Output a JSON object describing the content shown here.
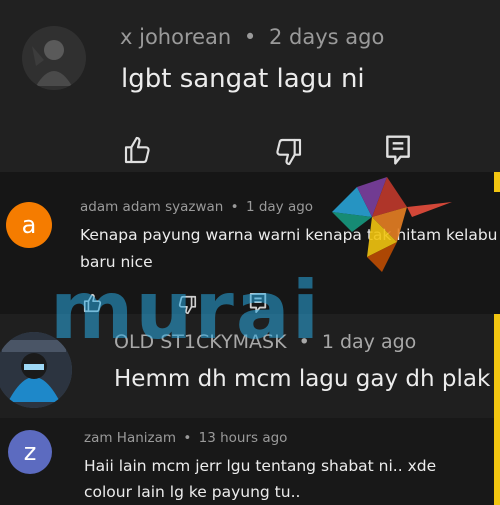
{
  "comments": [
    {
      "author": "x johorean",
      "time": "2 days ago",
      "text": "lgbt sangat lagu ni",
      "avatar_letter": "",
      "avatar_color": "#2a2a2a"
    },
    {
      "author": "adam adam syazwan",
      "time": "1 day ago",
      "text": "Kenapa payung warna warni kenapa tak hitam kelabu baru nice",
      "avatar_letter": "a",
      "avatar_color": "#f57c00"
    },
    {
      "author": "OLD ST1CKYMASK",
      "time": "1 day ago",
      "text": "Hemm dh mcm lagu gay dh plak",
      "avatar_letter": "",
      "avatar_color": "#3a4a5c"
    },
    {
      "author": "zam Hanizam",
      "time": "13 hours ago",
      "text": "Haii lain mcm jerr lgu tentang shabat ni.. xde colour lain lg ke payung tu..",
      "avatar_letter": "z",
      "avatar_color": "#5c6bc0"
    }
  ],
  "separator": "•",
  "icons": {
    "like": "thumbs-up-icon",
    "dislike": "thumbs-down-icon",
    "reply": "reply-comment-icon"
  },
  "watermark": {
    "text": "murai",
    "color": "#29aae1"
  },
  "colors": {
    "accent_yellow": "#f2c511",
    "meta_text": "#9a9a9a",
    "body_text": "#ececec"
  }
}
